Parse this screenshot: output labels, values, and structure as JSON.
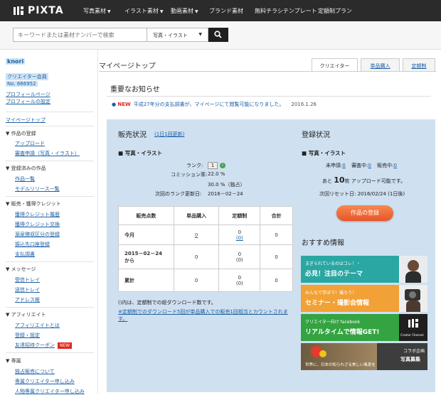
{
  "brand": {
    "name": "PIXTA"
  },
  "nav": {
    "items": [
      "写真素材",
      "イラスト素材",
      "動画素材",
      "ブランド素材",
      "無料チラシテンプレート",
      "定額制プラン"
    ]
  },
  "search": {
    "placeholder": "キーワードまたは素材ナンバーで検索",
    "category": "写真・イラスト"
  },
  "sidebar": {
    "username": "knori",
    "member_line1": "クリエイター会員",
    "member_line2": "No. 666952",
    "profile_page": "プロフィールページ",
    "profile_settings": "プロフィールの設定",
    "mypage_top": "マイページトップ",
    "s1_head": "作品の登録",
    "s1_i1": "アップロード",
    "s1_i2": "審査申請（写真・イラスト）",
    "s2_head": "登録済みの作品",
    "s2_i1": "作品一覧",
    "s2_i2": "モデルリリース一覧",
    "s3_head": "販売・獲得クレジット",
    "s3_i1": "獲得クレジット履歴",
    "s3_i2": "獲得クレジット交換",
    "s3_i3": "源泉徴収区分の登録",
    "s3_i4": "振込先口座登録",
    "s3_i5": "支払調書",
    "s4_head": "メッセージ",
    "s4_i1": "受信トレイ",
    "s4_i2": "送信トレイ",
    "s4_i3": "アドレス帳",
    "s5_head": "アフィリエイト",
    "s5_i1": "アフィリエイトとは",
    "s5_i2": "登録・設定",
    "s5_i3": "友達招待クーポン",
    "new_badge": "NEW",
    "s6_head": "専属",
    "s6_i1": "独占販売について",
    "s6_i2": "専属クリエイター申し込み",
    "s6_i3": "人物専属クリエイター申し込み"
  },
  "page": {
    "title": "マイページトップ",
    "tabs": [
      "クリエイター",
      "単品購入",
      "定額制"
    ]
  },
  "notice": {
    "title": "重要なお知らせ",
    "badge": "NEW",
    "text": "平成27年分の支払調書が、マイページにて閲覧可能になりました。",
    "date": "2016.1.26"
  },
  "sales": {
    "title": "販売状況",
    "period": "(1日1回更新)",
    "subtitle": "写真・イラスト",
    "rank_label": "ランク:",
    "rank_value": "1",
    "commission_label": "コミッション率:",
    "commission_value": "22.0 %",
    "commission_excl": "30.0 %（独占）",
    "next_rank_label": "次回のランク更新日:",
    "next_rank_value": "2016－02－24",
    "table": {
      "headers": [
        "販売点数",
        "単品購入",
        "定額制",
        "合計"
      ],
      "rows": [
        {
          "label": "今月",
          "single": "0",
          "sub_top": "0",
          "sub_bottom": "(0)",
          "total": "0"
        },
        {
          "label": "2015－02－24\nから",
          "single": "0",
          "sub_top": "0",
          "sub_bottom": "(0)",
          "total": "0"
        },
        {
          "label": "累計",
          "single": "0",
          "sub_top": "0",
          "sub_bottom": "(0)",
          "total": "0"
        }
      ]
    },
    "note1": "()内は、定額制での総ダウンロード数です。",
    "note2": "※定額制でのダウンロード5回が単品購入での販売1回相当とカウントされます。"
  },
  "registration": {
    "title": "登録状況",
    "subtitle": "写真・イラスト",
    "pending_label": "未申請:",
    "pending_value": "0",
    "review_label": "審査中:",
    "review_value": "0",
    "selling_label": "販売中:",
    "selling_value": "0",
    "remain_prefix": "あと",
    "remain_count": "10",
    "remain_unit": "枚",
    "remain_suffix": "アップロード可能です。",
    "reset_label": "次回リセット日:",
    "reset_value": "2016/02/24 (1日後)",
    "button": "作品の登録"
  },
  "recommend": {
    "title": "おすすめ情報",
    "b1_l1": "まぎられているのはコレ！・",
    "b1_l2": "必見！注目のテーマ",
    "b2_l1": "みんなで学ぼう！撮ろう！",
    "b2_l2": "セミナー・撮影会情報",
    "b3_l1": "クリエイター向け facebook",
    "b3_l2": "リアルタイムで情報GET!",
    "b3_tag": "Creator Channel",
    "b4_l1": "世界に、日本の知られざる美しい風景を",
    "b4_tag1": "コラボ企画",
    "b4_tag2": "写真募集"
  },
  "colors": {
    "nav_bg": "#2b2b2b",
    "panel_bg": "#cfe0f0",
    "link": "#1d5fa4",
    "button_orange": "#e8552a",
    "new_red": "#e0281e"
  }
}
